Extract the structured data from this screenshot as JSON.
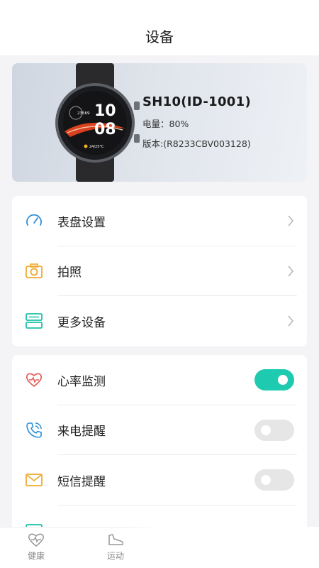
{
  "header": {
    "title": "设备"
  },
  "device": {
    "name": "SH10(ID-1001)",
    "battery": "电量：80%",
    "version": "版本:(R8233CBV003128)",
    "watch_face": {
      "steps": "23569",
      "hour": "10",
      "minute": "08",
      "weather": "24/25°C"
    }
  },
  "menu": {
    "items": [
      {
        "label": "表盘设置",
        "icon": "dial-gauge-icon"
      },
      {
        "label": "拍照",
        "icon": "camera-icon"
      },
      {
        "label": "更多设备",
        "icon": "devices-icon"
      }
    ]
  },
  "settings": {
    "items": [
      {
        "label": "心率监测",
        "icon": "heart-rate-icon",
        "enabled": true
      },
      {
        "label": "来电提醒",
        "icon": "phone-call-icon",
        "enabled": false
      },
      {
        "label": "短信提醒",
        "icon": "mail-icon",
        "enabled": false
      }
    ]
  },
  "tabbar": {
    "tabs": [
      {
        "label": "健康",
        "icon": "heart-pulse-icon"
      },
      {
        "label": "运动",
        "icon": "shoe-icon"
      }
    ]
  },
  "colors": {
    "toggle_on": "#1ecbb0",
    "toggle_off": "#e6e6e6",
    "icon_blue": "#2b8fd6",
    "icon_orange": "#f0a930",
    "icon_teal": "#1ec0a8",
    "icon_red": "#e45a5a"
  }
}
